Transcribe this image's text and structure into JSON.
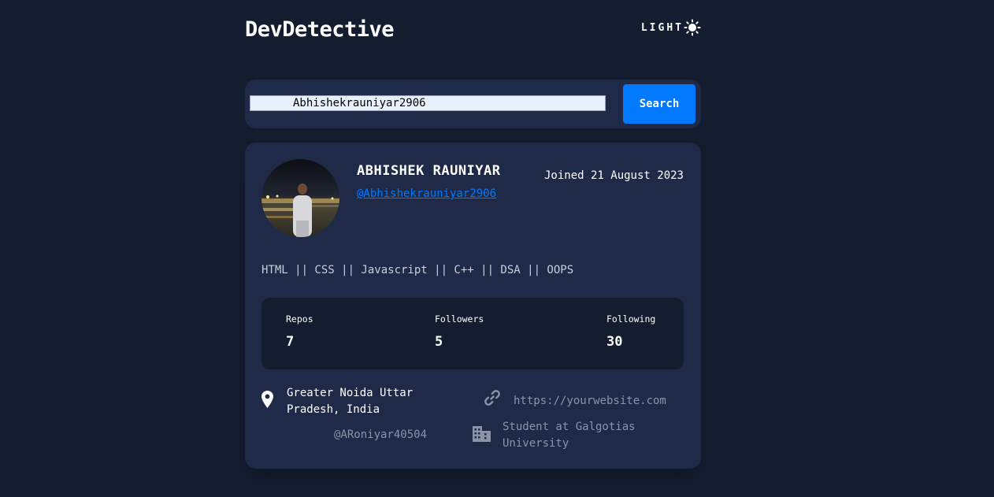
{
  "header": {
    "logo": "DevDetective",
    "mode_label": "LIGHT"
  },
  "search": {
    "value": "Abhishekrauniyar2906",
    "button_label": "Search"
  },
  "profile": {
    "name": "ABHISHEK RAUNIYAR",
    "username": "@Abhishekrauniyar2906",
    "joined": "Joined 21 August 2023",
    "bio": "HTML || CSS || Javascript || C++ || DSA || OOPS",
    "stats": {
      "repos_label": "Repos",
      "repos_value": "7",
      "followers_label": "Followers",
      "followers_value": "5",
      "following_label": "Following",
      "following_value": "30"
    },
    "links": {
      "location_line1": "Greater Noida Uttar",
      "location_line2": "Pradesh, India",
      "website": "https://yourwebsite.com",
      "twitter": "@ARoniyar40504",
      "company_line1": "Student at Galgotias",
      "company_line2": "University"
    }
  },
  "colors": {
    "background": "#141d2f",
    "card": "#1e2a47",
    "accent": "#0079ff",
    "muted": "#8b93a7"
  },
  "icons": [
    "sun-icon",
    "location-pin-icon",
    "link-icon",
    "building-icon"
  ]
}
